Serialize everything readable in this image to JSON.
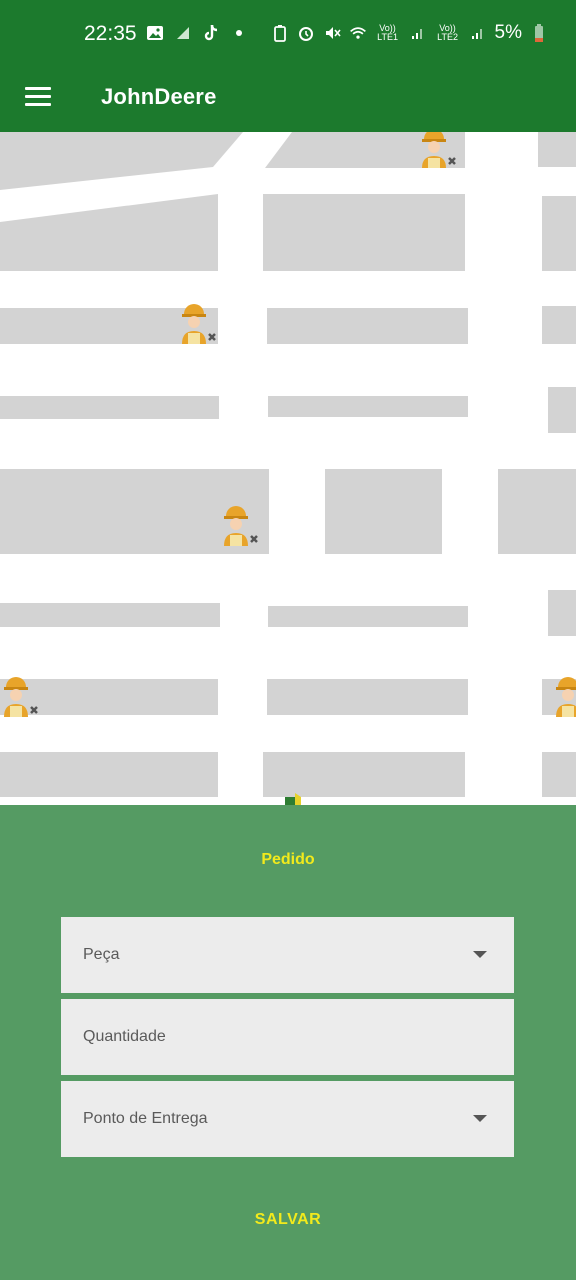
{
  "status_bar": {
    "time": "22:35",
    "battery": "5%",
    "sim1": "Vo)) LTE1",
    "sim2": "Vo)) LTE2",
    "icons": [
      "gallery-icon",
      "signal-icon",
      "tiktok-icon",
      "dot-icon",
      "battery-saver-icon",
      "alarm-icon",
      "mute-icon",
      "wifi-icon",
      "signal-icon",
      "battery-icon"
    ],
    "battery_color": "#e0663a"
  },
  "app_bar": {
    "title": "JohnDeere",
    "menu_icon": "hamburger-menu-icon",
    "color": "#1c7a2d"
  },
  "map": {
    "markers": [
      "mechanic-worker-icon",
      "mechanic-worker-icon",
      "mechanic-worker-icon",
      "mechanic-worker-icon",
      "mechanic-worker-icon",
      "current-location-icon"
    ]
  },
  "form": {
    "title": "Pedido",
    "fields": [
      {
        "label": "Peça",
        "type": "dropdown"
      },
      {
        "label": "Quantidade",
        "type": "text"
      },
      {
        "label": "Ponto de Entrega",
        "type": "dropdown"
      }
    ],
    "submit_label": "SALVAR",
    "panel_color": "#559b63",
    "accent_color": "#f2ea1c"
  }
}
